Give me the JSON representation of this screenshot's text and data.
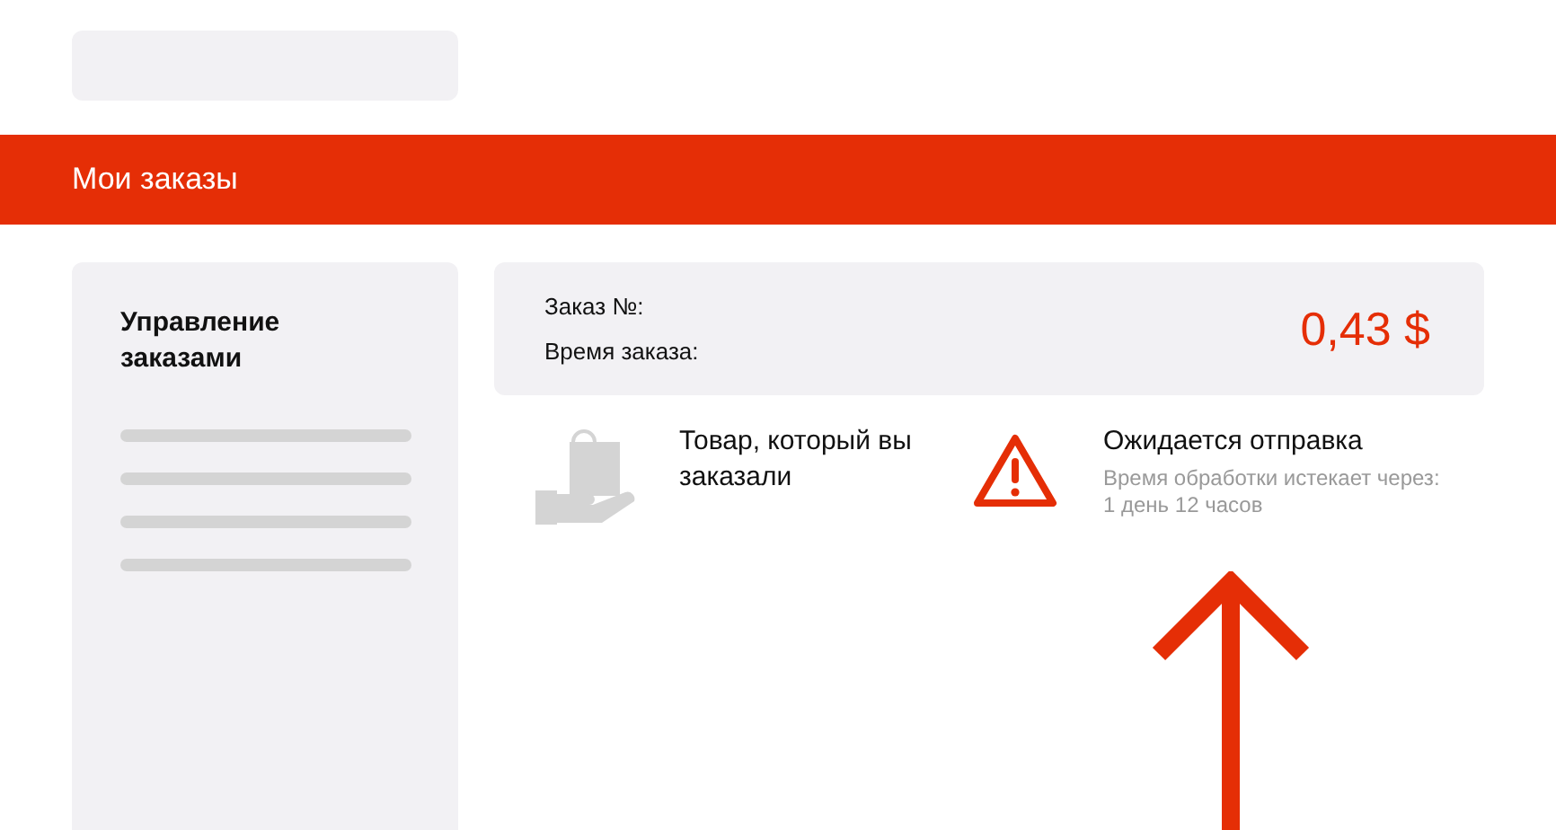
{
  "header": {
    "title": "Мои заказы"
  },
  "sidebar": {
    "title": "Управление заказами"
  },
  "order": {
    "number_label": "Заказ №:",
    "time_label": "Время заказа:",
    "price": "0,43 $"
  },
  "product": {
    "text": "Товар, который вы заказали"
  },
  "status": {
    "title": "Ожидается отправка",
    "note": "Время обработки истекает через:",
    "remaining": "1 день 12 часов"
  }
}
